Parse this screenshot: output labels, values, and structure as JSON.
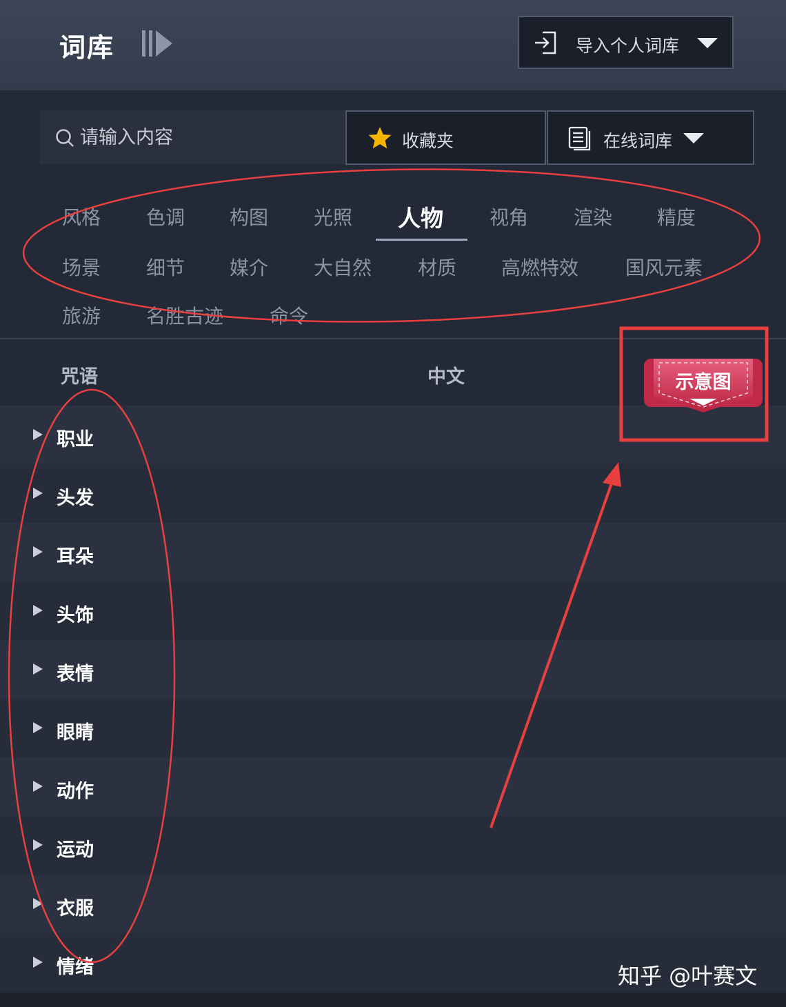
{
  "header": {
    "title": "词库",
    "import_label": "导入个人词库"
  },
  "search": {
    "placeholder": "请输入内容"
  },
  "toolbar": {
    "favorites_label": "收藏夹",
    "online_label": "在线词库"
  },
  "tabs": [
    "风格",
    "色调",
    "构图",
    "光照",
    "人物",
    "视角",
    "渲染",
    "精度",
    "场景",
    "细节",
    "媒介",
    "大自然",
    "材质",
    "高燃特效",
    "国风元素",
    "旅游",
    "名胜古迹",
    "命令"
  ],
  "active_tab": "人物",
  "table": {
    "columns": [
      "咒语",
      "中文"
    ],
    "rows": [
      "职业",
      "头发",
      "耳朵",
      "头饰",
      "表情",
      "眼睛",
      "动作",
      "运动",
      "衣服",
      "情绪"
    ]
  },
  "annotation": {
    "ribbon_label": "示意图",
    "ribbon_color": "#d63a5c",
    "mark_color": "#e8403f"
  },
  "watermark": "知乎 @叶赛文",
  "icons": [
    "collapse-panel-icon",
    "import-icon",
    "chevron-down-icon",
    "search-icon",
    "star-icon",
    "document-icon",
    "triangle-right-icon"
  ]
}
